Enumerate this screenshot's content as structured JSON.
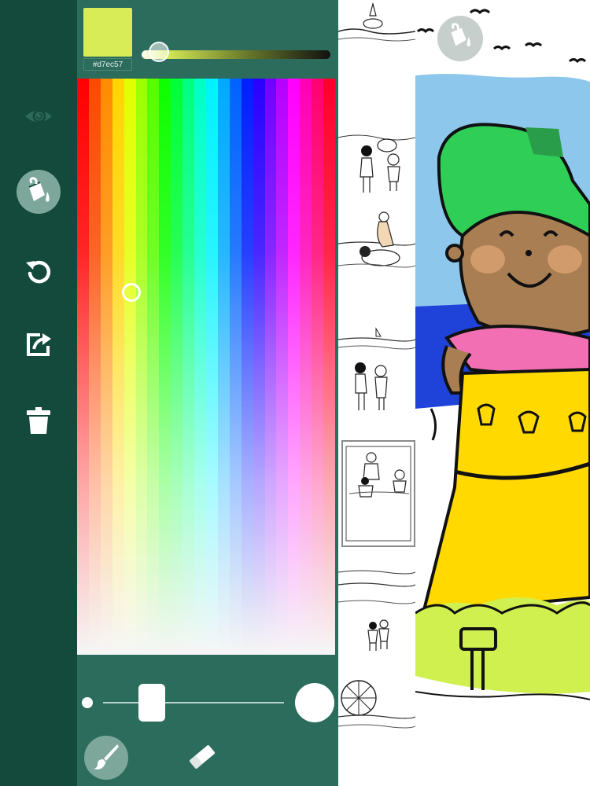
{
  "toolbar": {
    "tools": [
      {
        "name": "preview",
        "icon": "eye-swirl-icon"
      },
      {
        "name": "paint-bucket",
        "icon": "paint-bucket-icon",
        "active": true
      },
      {
        "name": "undo",
        "icon": "undo-icon"
      },
      {
        "name": "share",
        "icon": "share-icon"
      },
      {
        "name": "delete",
        "icon": "trash-icon"
      }
    ]
  },
  "color_panel": {
    "selected_hex": "#d7ec57",
    "swatch_color": "#d7ec57",
    "brush_size_level": 0.27
  },
  "colors": {
    "toolbar_bg": "#134a3b",
    "panel_bg": "#2b6c5c",
    "accent": "#d7ec57"
  },
  "page_strip": {
    "selected_index": 4
  },
  "canvas": {
    "fill_button_icon": "paint-bucket-icon"
  }
}
